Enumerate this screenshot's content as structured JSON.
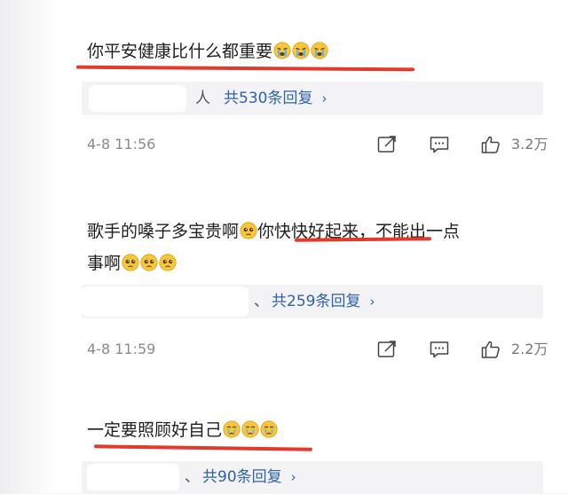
{
  "comments": [
    {
      "text": "你平安健康比什么都重要",
      "emoji": [
        "crying-emoji",
        "crying-emoji",
        "crying-emoji"
      ],
      "reply_name_tail": "人",
      "reply_count": "共530条回复",
      "timestamp": "4-8 11:56",
      "likes": "3.2万"
    },
    {
      "text_part1": "歌手的嗓子多宝贵啊",
      "text_part2": "你快快好起来",
      "text_part3": "，不能出一点",
      "text_line2": "事啊",
      "reply_name_tail": "、",
      "reply_count": "共259条回复",
      "timestamp": "4-8 11:59",
      "likes": "2.2万"
    },
    {
      "text": "一定要照顾好自己",
      "emoji": [
        "tearful-emoji",
        "tearful-emoji",
        "tearful-emoji"
      ],
      "reply_name_tail": "、",
      "reply_count": "共90条回复"
    }
  ],
  "colors": {
    "underline": "#e23a2b",
    "link": "#2f63a8",
    "meta": "#8a8a8a"
  },
  "icons": [
    "share-icon",
    "comment-icon",
    "like-icon",
    "chevron-right-icon"
  ]
}
